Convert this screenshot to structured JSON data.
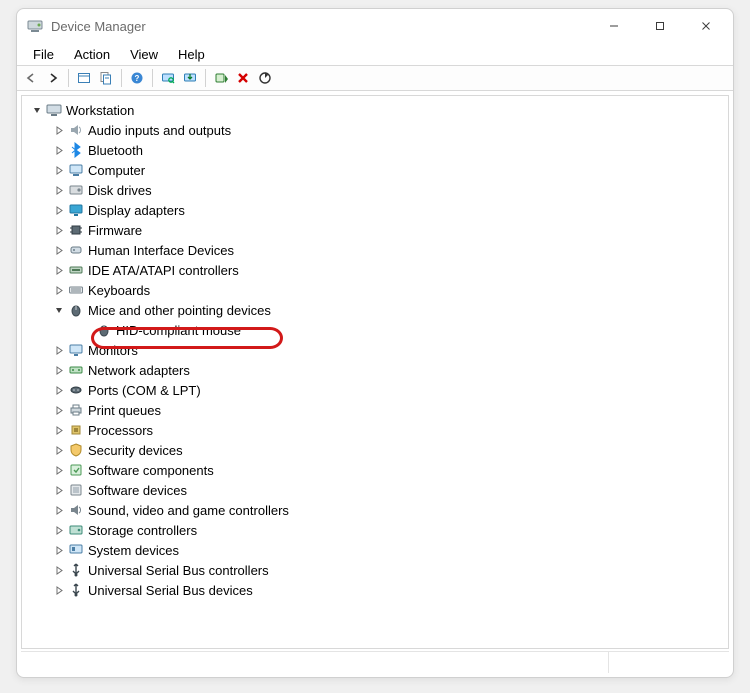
{
  "window": {
    "title": "Device Manager"
  },
  "menu": {
    "file": "File",
    "action": "Action",
    "view": "View",
    "help": "Help"
  },
  "toolbar_icons": {
    "back": "back-arrow-icon",
    "forward": "forward-arrow-icon",
    "show_hidden": "show-hidden-icon",
    "properties": "properties-page-icon",
    "help": "help-icon",
    "scan": "scan-hardware-icon",
    "enable": "enable-device-icon",
    "disable": "disable-device-icon",
    "uninstall": "uninstall-device-icon",
    "update": "update-driver-icon"
  },
  "tree": {
    "root": {
      "label": "Workstation",
      "icon": "computer-root-icon"
    },
    "categories": [
      {
        "key": "audio",
        "label": "Audio inputs and outputs",
        "icon": "speaker-icon",
        "expanded": false
      },
      {
        "key": "bluetooth",
        "label": "Bluetooth",
        "icon": "bluetooth-icon",
        "expanded": false
      },
      {
        "key": "computer",
        "label": "Computer",
        "icon": "pc-icon",
        "expanded": false
      },
      {
        "key": "disks",
        "label": "Disk drives",
        "icon": "disk-icon",
        "expanded": false
      },
      {
        "key": "display",
        "label": "Display adapters",
        "icon": "display-icon",
        "expanded": false
      },
      {
        "key": "firmware",
        "label": "Firmware",
        "icon": "chip-icon",
        "expanded": false
      },
      {
        "key": "hid",
        "label": "Human Interface Devices",
        "icon": "hid-icon",
        "expanded": false
      },
      {
        "key": "ide",
        "label": "IDE ATA/ATAPI controllers",
        "icon": "ide-icon",
        "expanded": false
      },
      {
        "key": "keyboards",
        "label": "Keyboards",
        "icon": "keyboard-icon",
        "expanded": false
      },
      {
        "key": "mice",
        "label": "Mice and other pointing devices",
        "icon": "mouse-icon",
        "expanded": true,
        "children": [
          {
            "key": "hidmouse",
            "label": "HID-compliant mouse",
            "icon": "mouse-icon",
            "highlighted": true
          }
        ]
      },
      {
        "key": "monitors",
        "label": "Monitors",
        "icon": "monitor-icon",
        "expanded": false
      },
      {
        "key": "network",
        "label": "Network adapters",
        "icon": "network-icon",
        "expanded": false
      },
      {
        "key": "ports",
        "label": "Ports (COM & LPT)",
        "icon": "port-icon",
        "expanded": false
      },
      {
        "key": "printq",
        "label": "Print queues",
        "icon": "printer-icon",
        "expanded": false
      },
      {
        "key": "processors",
        "label": "Processors",
        "icon": "cpu-icon",
        "expanded": false
      },
      {
        "key": "security",
        "label": "Security devices",
        "icon": "security-icon",
        "expanded": false
      },
      {
        "key": "swcomp",
        "label": "Software components",
        "icon": "swcomp-icon",
        "expanded": false
      },
      {
        "key": "swdev",
        "label": "Software devices",
        "icon": "swdev-icon",
        "expanded": false
      },
      {
        "key": "sound",
        "label": "Sound, video and game controllers",
        "icon": "sound-icon",
        "expanded": false
      },
      {
        "key": "storage",
        "label": "Storage controllers",
        "icon": "storage-icon",
        "expanded": false
      },
      {
        "key": "system",
        "label": "System devices",
        "icon": "system-icon",
        "expanded": false
      },
      {
        "key": "usbctrl",
        "label": "Universal Serial Bus controllers",
        "icon": "usb-icon",
        "expanded": false
      },
      {
        "key": "usbdev",
        "label": "Universal Serial Bus devices",
        "icon": "usb-icon",
        "expanded": false
      }
    ]
  },
  "annotation": {
    "color": "#d21919"
  }
}
